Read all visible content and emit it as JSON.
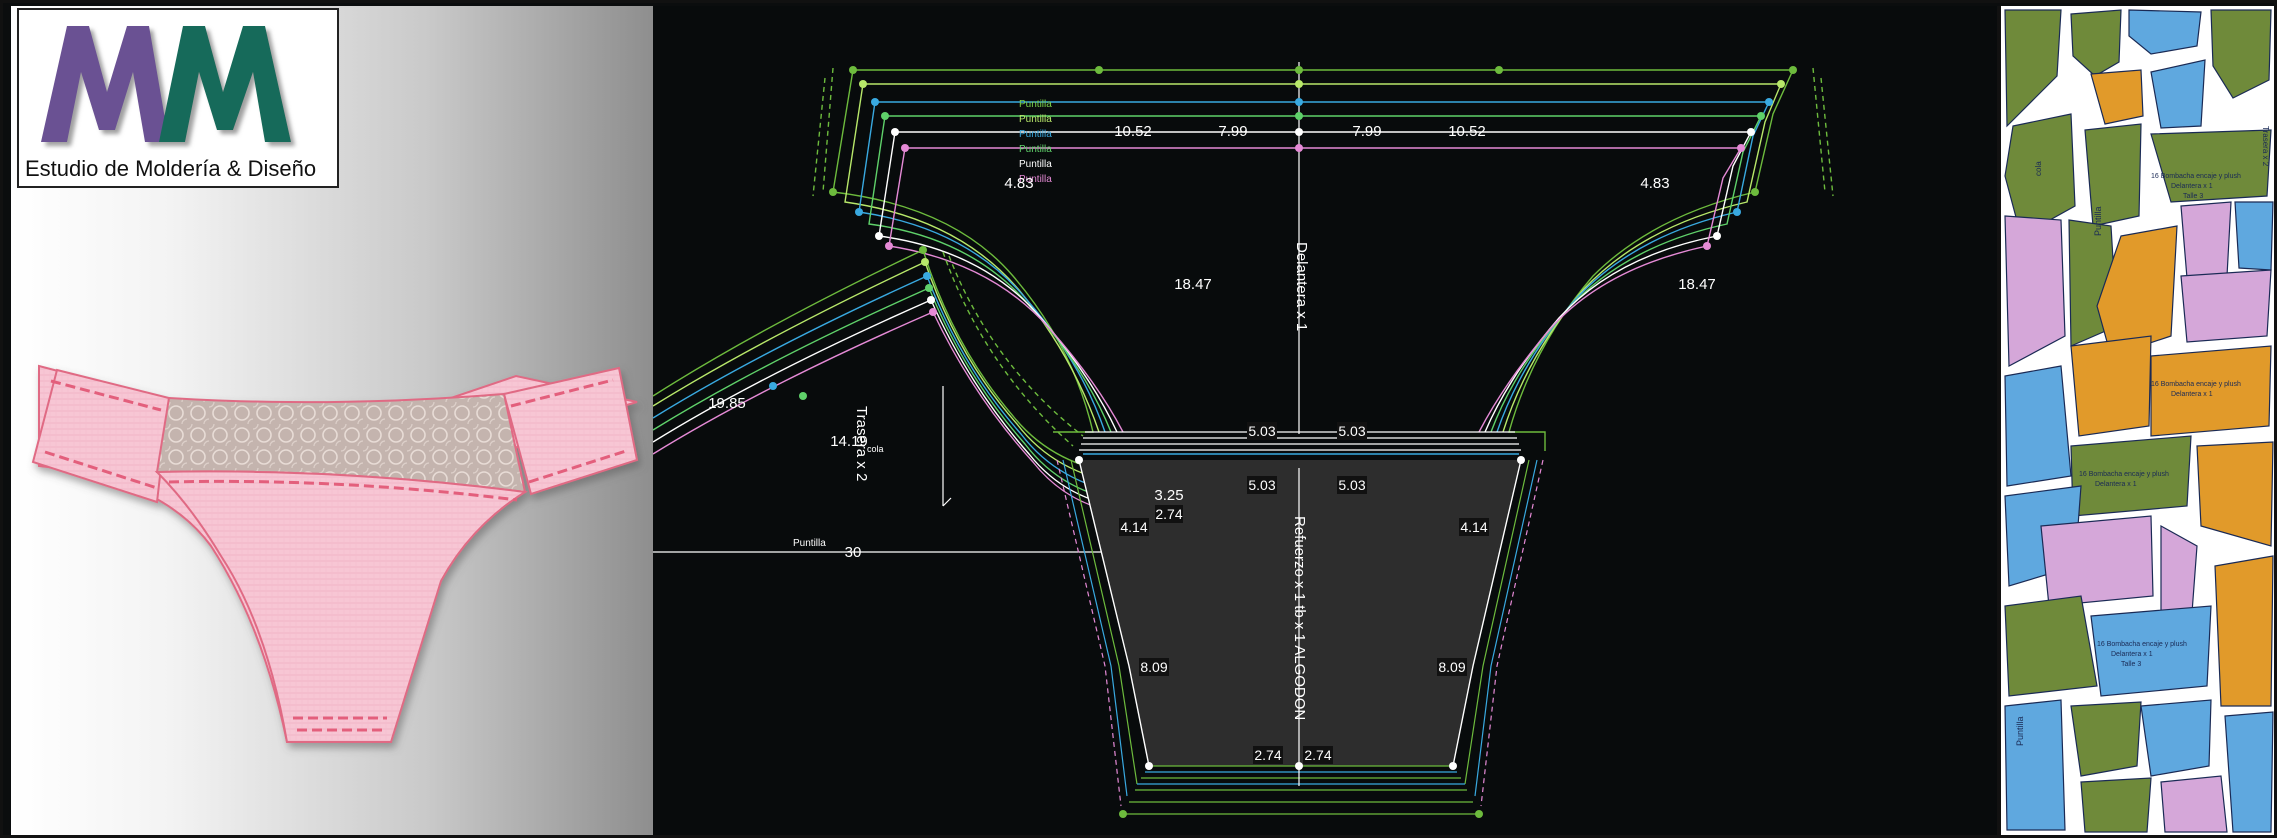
{
  "brand": {
    "logo_letters": "MM",
    "caption": "Estudio de Moldería & Diseño",
    "colors": {
      "purple": "#6b5193",
      "green": "#166a5a"
    }
  },
  "cad": {
    "legend": [
      "Puntilla",
      "Puntilla",
      "Puntilla",
      "Puntilla",
      "Puntilla",
      "Puntilla"
    ],
    "legend_colors": [
      "#7cd24a",
      "#b8e86a",
      "#39a9e0",
      "#5fd16a",
      "#ffffff",
      "#e58ad6"
    ],
    "front_label": "Delantera x 1",
    "back_label": "Trasera x 2",
    "gusset_label": "Refuerzo x 1 tb x 1 ALGODON",
    "cola_label": "cola",
    "puntilla_label": "Puntilla",
    "dims": {
      "top_left": "10.52",
      "top_mid_left": "7.99",
      "top_mid_right": "7.99",
      "top_right": "10.52",
      "side_left": "4.83",
      "side_right": "4.83",
      "curve_left": "18.47",
      "curve_right": "18.47",
      "back_curve": "19.85",
      "back_inner": "14.19",
      "back_low": "3.25",
      "back_height": "2.74",
      "back_base": "30",
      "waist_left": "5.03",
      "waist_right": "5.03",
      "gusset_top_left": "5.03",
      "gusset_top_right": "5.03",
      "gusset_side_left": "4.14",
      "gusset_side_right": "4.14",
      "gusset_mid_left": "8.09",
      "gusset_mid_right": "8.09",
      "gusset_bottom_left": "2.74",
      "gusset_bottom_right": "2.74"
    }
  },
  "layout_sheet": {
    "piece_labels": [
      "16 Bombacha encaje y plush",
      "Delantera x 1",
      "Talle 3",
      "Puntilla",
      "cola",
      "Trasera x 2"
    ]
  }
}
